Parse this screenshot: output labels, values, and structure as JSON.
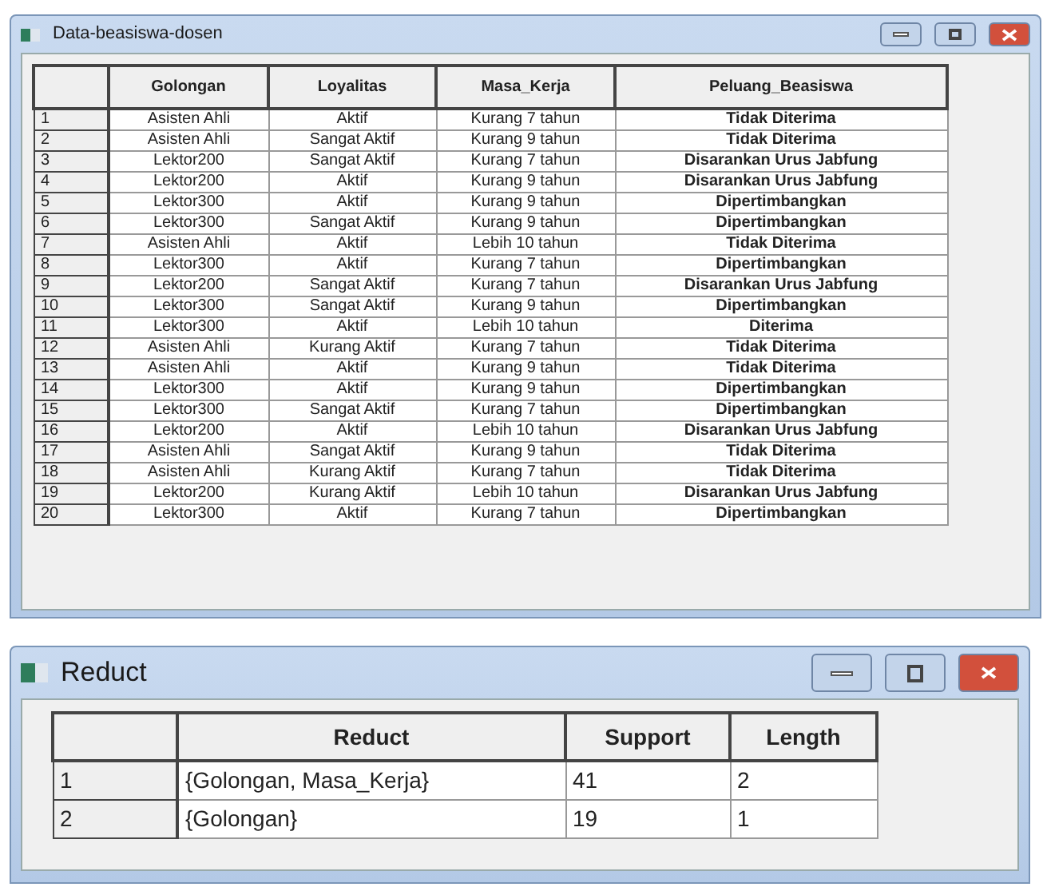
{
  "windows": [
    {
      "title": "Data-beasiswa-dosen",
      "columns": [
        "",
        "Golongan",
        "Loyalitas",
        "Masa_Kerja",
        "Peluang_Beasiswa"
      ],
      "rows": [
        [
          "1",
          "Asisten Ahli",
          "Aktif",
          "Kurang 7 tahun",
          "Tidak Diterima"
        ],
        [
          "2",
          "Asisten Ahli",
          "Sangat Aktif",
          "Kurang 9 tahun",
          "Tidak Diterima"
        ],
        [
          "3",
          "Lektor200",
          "Sangat Aktif",
          "Kurang 7 tahun",
          "Disarankan Urus Jabfung"
        ],
        [
          "4",
          "Lektor200",
          "Aktif",
          "Kurang 9 tahun",
          "Disarankan Urus Jabfung"
        ],
        [
          "5",
          "Lektor300",
          "Aktif",
          "Kurang 9 tahun",
          "Dipertimbangkan"
        ],
        [
          "6",
          "Lektor300",
          "Sangat Aktif",
          "Kurang 9 tahun",
          "Dipertimbangkan"
        ],
        [
          "7",
          "Asisten Ahli",
          "Aktif",
          "Lebih 10 tahun",
          "Tidak Diterima"
        ],
        [
          "8",
          "Lektor300",
          "Aktif",
          "Kurang 7 tahun",
          "Dipertimbangkan"
        ],
        [
          "9",
          "Lektor200",
          "Sangat Aktif",
          "Kurang 7 tahun",
          "Disarankan Urus Jabfung"
        ],
        [
          "10",
          "Lektor300",
          "Sangat Aktif",
          "Kurang 9 tahun",
          "Dipertimbangkan"
        ],
        [
          "11",
          "Lektor300",
          "Aktif",
          "Lebih 10 tahun",
          "Diterima"
        ],
        [
          "12",
          "Asisten Ahli",
          "Kurang Aktif",
          "Kurang 7 tahun",
          "Tidak Diterima"
        ],
        [
          "13",
          "Asisten Ahli",
          "Aktif",
          "Kurang 9 tahun",
          "Tidak Diterima"
        ],
        [
          "14",
          "Lektor300",
          "Aktif",
          "Kurang 9 tahun",
          "Dipertimbangkan"
        ],
        [
          "15",
          "Lektor300",
          "Sangat Aktif",
          "Kurang 7 tahun",
          "Dipertimbangkan"
        ],
        [
          "16",
          "Lektor200",
          "Aktif",
          "Lebih 10 tahun",
          "Disarankan Urus Jabfung"
        ],
        [
          "17",
          "Asisten Ahli",
          "Sangat Aktif",
          "Kurang 9 tahun",
          "Tidak Diterima"
        ],
        [
          "18",
          "Asisten Ahli",
          "Kurang Aktif",
          "Kurang 7 tahun",
          "Tidak Diterima"
        ],
        [
          "19",
          "Lektor200",
          "Kurang Aktif",
          "Lebih 10 tahun",
          "Disarankan Urus Jabfung"
        ],
        [
          "20",
          "Lektor300",
          "Aktif",
          "Kurang 7 tahun",
          "Dipertimbangkan"
        ]
      ]
    },
    {
      "title": "Reduct",
      "columns": [
        "",
        "Reduct",
        "Support",
        "Length"
      ],
      "rows": [
        [
          "1",
          "{Golongan, Masa_Kerja}",
          "41",
          "2"
        ],
        [
          "2",
          "{Golongan}",
          "19",
          "1"
        ]
      ]
    }
  ]
}
